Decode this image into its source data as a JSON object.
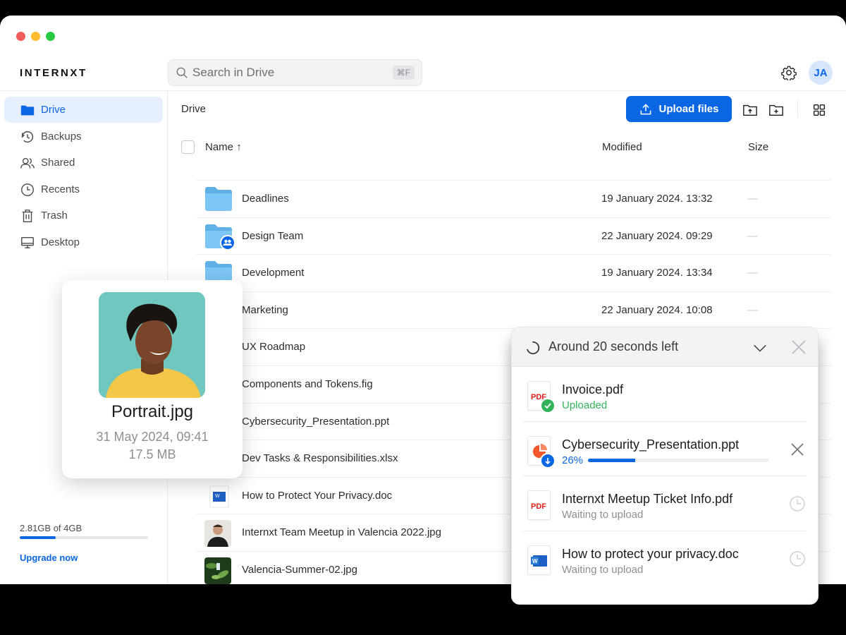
{
  "app": {
    "logo": "INTERNXT",
    "search": {
      "placeholder": "Search in Drive",
      "shortcut": "⌘F"
    },
    "avatar_initials": "JA",
    "accent": "#0b66e4"
  },
  "sidebar": {
    "items": [
      {
        "label": "Drive",
        "icon": "folder-icon",
        "active": true
      },
      {
        "label": "Backups",
        "icon": "history-icon"
      },
      {
        "label": "Shared",
        "icon": "users-icon"
      },
      {
        "label": "Recents",
        "icon": "clock-icon"
      },
      {
        "label": "Trash",
        "icon": "trash-icon"
      },
      {
        "label": "Desktop",
        "icon": "desktop-icon"
      }
    ],
    "storage": {
      "text": "2.81GB of 4GB",
      "used_fraction": 0.28
    },
    "upgrade_label": "Upgrade now"
  },
  "main": {
    "breadcrumb": "Drive",
    "upload_label": "Upload files",
    "columns": {
      "name": "Name",
      "sort": "↑",
      "modified": "Modified",
      "size": "Size"
    },
    "files": [
      {
        "name": "Deadlines",
        "type": "folder",
        "modified": "19 January 2024. 13:32",
        "size": "—"
      },
      {
        "name": "Design Team",
        "type": "shared-folder",
        "modified": "22 January 2024. 09:29",
        "size": "—"
      },
      {
        "name": "Development",
        "type": "folder",
        "modified": "19 January 2024. 13:34",
        "size": "—"
      },
      {
        "name": "Marketing",
        "type": "folder",
        "modified": "22 January 2024. 10:08",
        "size": "—"
      },
      {
        "name": "UX Roadmap",
        "type": "folder",
        "modified": "",
        "size": ""
      },
      {
        "name": "Components and Tokens.fig",
        "type": "fig",
        "modified": "",
        "size": ""
      },
      {
        "name": "Cybersecurity_Presentation.ppt",
        "type": "ppt",
        "modified": "",
        "size": ""
      },
      {
        "name": "Dev Tasks & Responsibilities.xlsx",
        "type": "xlsx",
        "modified": "",
        "size": ""
      },
      {
        "name": "How to Protect Your Privacy.doc",
        "type": "doc",
        "modified": "",
        "size": ""
      },
      {
        "name": "Internxt Team Meetup in Valencia 2022.jpg",
        "type": "image-person",
        "modified": "",
        "size": ""
      },
      {
        "name": "Valencia-Summer-02.jpg",
        "type": "image-plant",
        "modified": "",
        "size": ""
      }
    ]
  },
  "preview": {
    "name": "Portrait.jpg",
    "date": "31 May 2024, 09:41",
    "size": "17.5 MB"
  },
  "uploader": {
    "title": "Around 20 seconds left",
    "items": [
      {
        "name": "Invoice.pdf",
        "status": "Uploaded",
        "kind": "pdf",
        "state": "done"
      },
      {
        "name": "Cybersecurity_Presentation.ppt",
        "status": "26%",
        "kind": "ppt",
        "state": "uploading",
        "progress": 0.26
      },
      {
        "name": "Internxt Meetup Ticket Info.pdf",
        "status": "Waiting to upload",
        "kind": "pdf",
        "state": "waiting"
      },
      {
        "name": "How to protect your privacy.doc",
        "status": "Waiting to upload",
        "kind": "doc",
        "state": "waiting"
      }
    ]
  }
}
